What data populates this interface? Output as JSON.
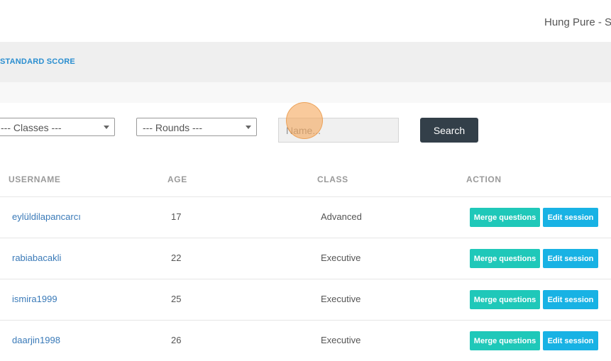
{
  "header": {
    "user_name": "Hung Pure - S"
  },
  "nav": {
    "active_label": "STANDARD SCORE"
  },
  "filters": {
    "classes_label": "--- Classes ---",
    "rounds_label": "--- Rounds ---",
    "name_placeholder": "Name...",
    "search_label": "Search"
  },
  "table": {
    "headers": {
      "username": "USERNAME",
      "age": "AGE",
      "class": "CLASS",
      "action": "ACTION"
    },
    "rows": [
      {
        "username": "eylüldilapancarcı",
        "age": "17",
        "class": "Advanced",
        "merge_label": "Merge questions",
        "edit_label": "Edit session"
      },
      {
        "username": "rabiabacakli",
        "age": "22",
        "class": "Executive",
        "merge_label": "Merge questions",
        "edit_label": "Edit session"
      },
      {
        "username": "ismira1999",
        "age": "25",
        "class": "Executive",
        "merge_label": "Merge questions",
        "edit_label": "Edit session"
      },
      {
        "username": "daarjin1998",
        "age": "26",
        "class": "Executive",
        "merge_label": "Merge questions",
        "edit_label": "Edit session"
      }
    ]
  },
  "colors": {
    "nav_link": "#2a8ed0",
    "search_button": "#333f49",
    "merge_button": "#1fc8b9",
    "edit_button": "#18b2e4"
  }
}
